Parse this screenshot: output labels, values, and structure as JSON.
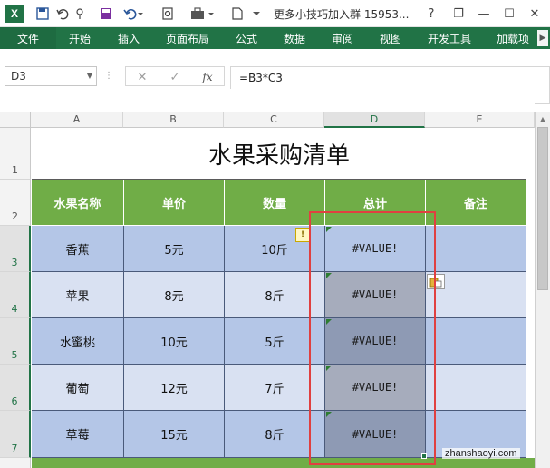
{
  "window": {
    "title": "更多小技巧加入群 15953...",
    "help_icon": "?",
    "restore_icon": "❐",
    "minimize_icon": "—",
    "maximize_icon": "☐",
    "close_icon": "✕"
  },
  "app": {
    "logo_letter": "X",
    "accent_color": "#217346"
  },
  "ribbon": {
    "tabs": [
      "文件",
      "开始",
      "插入",
      "页面布局",
      "公式",
      "数据",
      "审阅",
      "视图",
      "开发工具",
      "加载项"
    ]
  },
  "formula_bar": {
    "name_box": "D3",
    "cancel_icon": "✕",
    "enter_icon": "✓",
    "fx_label": "fx",
    "formula": "=B3*C3"
  },
  "sheet": {
    "columns": [
      "A",
      "B",
      "C",
      "D",
      "E"
    ],
    "selected_column": "D",
    "rows": [
      "1",
      "2",
      "3",
      "4",
      "5",
      "6",
      "7"
    ],
    "title": "水果采购清单",
    "headers": [
      "水果名称",
      "单价",
      "数量",
      "总计",
      "备注"
    ],
    "data": [
      [
        "香蕉",
        "5元",
        "10斤",
        "#VALUE!",
        ""
      ],
      [
        "苹果",
        "8元",
        "8斤",
        "#VALUE!",
        ""
      ],
      [
        "水蜜桃",
        "10元",
        "5斤",
        "#VALUE!",
        ""
      ],
      [
        "葡萄",
        "12元",
        "7斤",
        "#VALUE!",
        ""
      ],
      [
        "草莓",
        "15元",
        "8斤",
        "#VALUE!",
        ""
      ]
    ],
    "header_color": "#70ad47",
    "band_dark": "#b4c6e7",
    "band_light": "#d9e1f2",
    "highlight_color": "#e04040"
  },
  "watermark": "zhanshaoyi.com"
}
